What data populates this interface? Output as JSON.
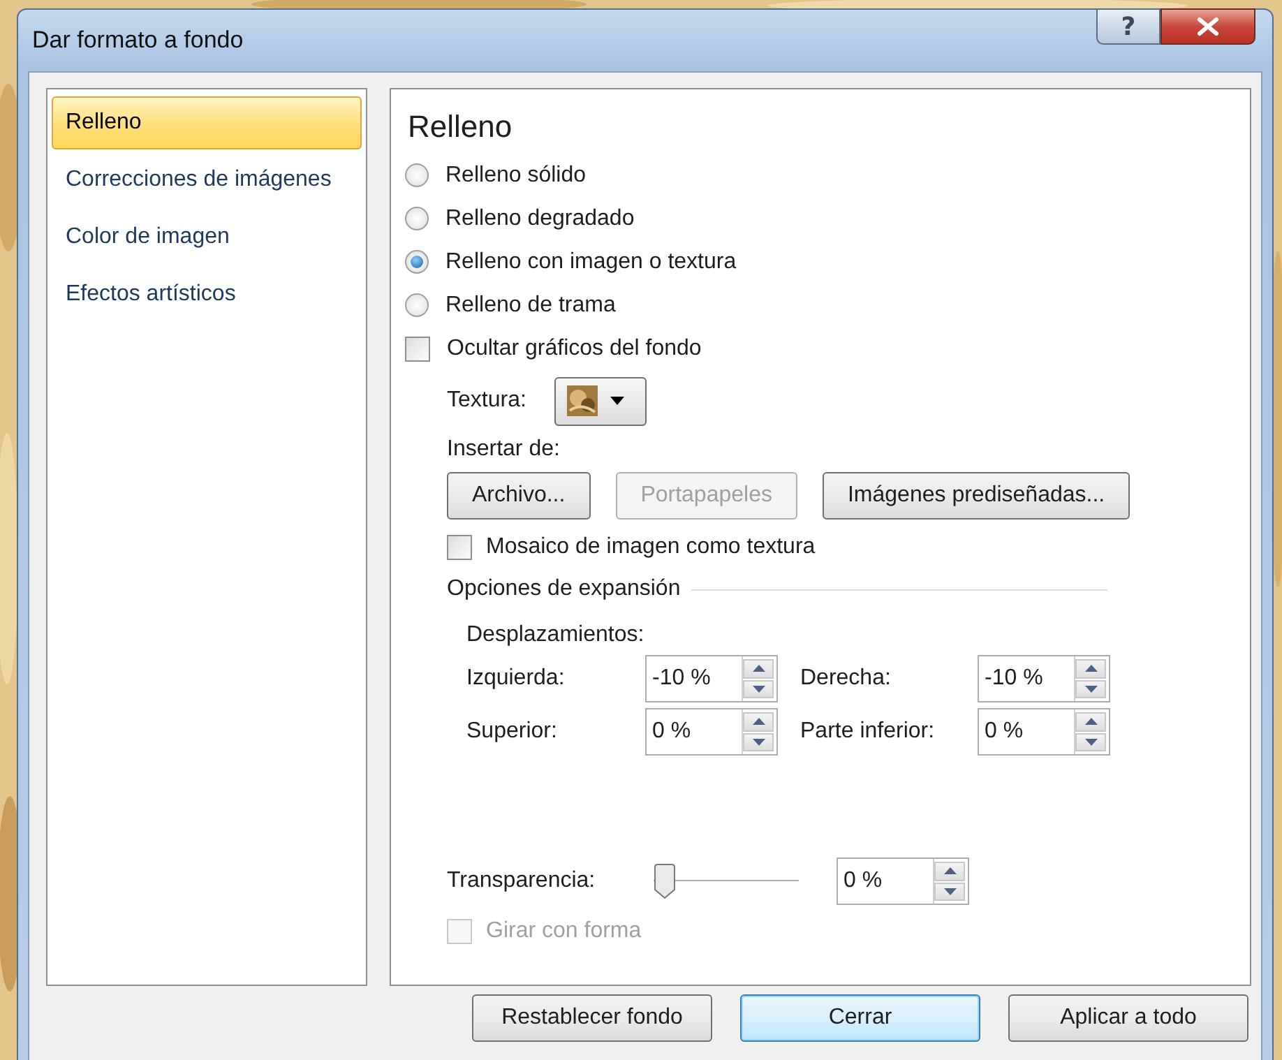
{
  "window": {
    "title": "Dar formato a fondo",
    "help_label": "?"
  },
  "sidebar": {
    "items": [
      {
        "label": "Relleno",
        "selected": true
      },
      {
        "label": "Correcciones de imágenes",
        "selected": false
      },
      {
        "label": "Color de imagen",
        "selected": false
      },
      {
        "label": "Efectos artísticos",
        "selected": false
      }
    ]
  },
  "panel": {
    "heading": "Relleno",
    "fill_options": [
      {
        "label": "Relleno sólido",
        "selected": false
      },
      {
        "label": "Relleno degradado",
        "selected": false
      },
      {
        "label": "Relleno con imagen o textura",
        "selected": true
      },
      {
        "label": "Relleno de trama",
        "selected": false
      }
    ],
    "hide_background_graphics": {
      "label": "Ocultar gráficos del fondo",
      "checked": false
    },
    "texture": {
      "label": "Textura:"
    },
    "insert_from": {
      "label": "Insertar de:",
      "buttons": [
        {
          "label": "Archivo...",
          "disabled": false
        },
        {
          "label": "Portapapeles",
          "disabled": true
        },
        {
          "label": "Imágenes prediseñadas...",
          "disabled": false
        }
      ]
    },
    "tile": {
      "label": "Mosaico de imagen como textura",
      "checked": false
    },
    "stretch_options": {
      "heading": "Opciones de expansión",
      "offsets_label": "Desplazamientos:",
      "fields": [
        {
          "label": "Izquierda:",
          "value": "-10 %"
        },
        {
          "label": "Derecha:",
          "value": "-10 %"
        },
        {
          "label": "Superior:",
          "value": "0 %"
        },
        {
          "label": "Parte inferior:",
          "value": "0 %"
        }
      ]
    },
    "transparency": {
      "label": "Transparencia:",
      "level": 0,
      "value": "0 %"
    },
    "rotate_with_shape": {
      "label": "Girar con forma",
      "checked": false,
      "disabled": true
    }
  },
  "footer_buttons": [
    {
      "label": "Restablecer fondo",
      "default": false
    },
    {
      "label": "Cerrar",
      "default": true
    },
    {
      "label": "Aplicar a todo",
      "default": false
    }
  ]
}
